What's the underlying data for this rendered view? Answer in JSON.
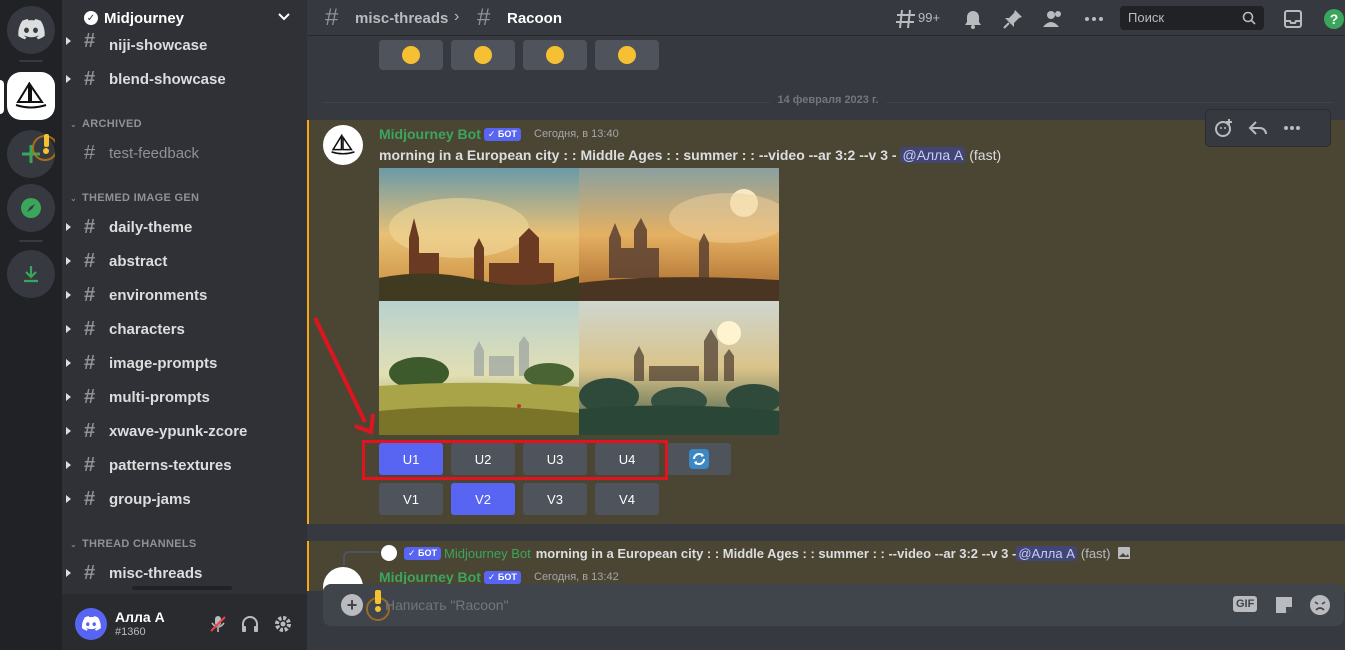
{
  "server": {
    "name": "Midjourney"
  },
  "channels": {
    "top": [
      {
        "label": "niji-showcase"
      },
      {
        "label": "blend-showcase"
      }
    ],
    "archived_label": "ARCHIVED",
    "archived": [
      {
        "label": "test-feedback"
      }
    ],
    "themed_label": "THEMED IMAGE GEN",
    "themed": [
      {
        "label": "daily-theme"
      },
      {
        "label": "abstract"
      },
      {
        "label": "environments"
      },
      {
        "label": "characters"
      },
      {
        "label": "image-prompts"
      },
      {
        "label": "multi-prompts"
      },
      {
        "label": "xwave-ypunk-zcore"
      },
      {
        "label": "patterns-textures"
      },
      {
        "label": "group-jams"
      }
    ],
    "threads_label": "THREAD CHANNELS",
    "threads": [
      {
        "label": "misc-threads"
      }
    ]
  },
  "user": {
    "name": "Алла А",
    "tag": "#1360"
  },
  "header": {
    "parent_channel": "misc-threads",
    "thread": "Racoon",
    "threads_count": "99+",
    "search_placeholder": "Поиск"
  },
  "divider_date": "14 февраля 2023 г.",
  "message": {
    "author": "Midjourney Bot",
    "badge": "✓ БОТ",
    "time": "Сегодня, в 13:40",
    "prompt": "morning in a European city : : Middle Ages : : summer : : --video --ar 3:2 --v 3 - ",
    "mention": "@Алла А",
    "speed": "(fast)",
    "upscale_buttons": [
      "U1",
      "U2",
      "U3",
      "U4"
    ],
    "variation_buttons": [
      "V1",
      "V2",
      "V3",
      "V4"
    ],
    "active_upscale": "U1",
    "active_variation": "V2"
  },
  "message2": {
    "reply_badge": "✓ БОТ",
    "reply_author": "Midjourney Bot",
    "reply_prompt": "morning in a European city : : Middle Ages : : summer : : --video --ar 3:2 --v 3 - ",
    "reply_mention": "@Алла А",
    "reply_speed": "(fast)",
    "author": "Midjourney Bot",
    "badge": "✓ БОТ",
    "time": "Сегодня, в 13:42"
  },
  "composer": {
    "placeholder": "Написать \"Racoon\"",
    "gif_label": "GIF"
  },
  "colors": {
    "accent": "#5865f2",
    "highlight_border": "#faa81a",
    "annotation_red": "#e0141e",
    "bot_name": "#3ba55c"
  }
}
